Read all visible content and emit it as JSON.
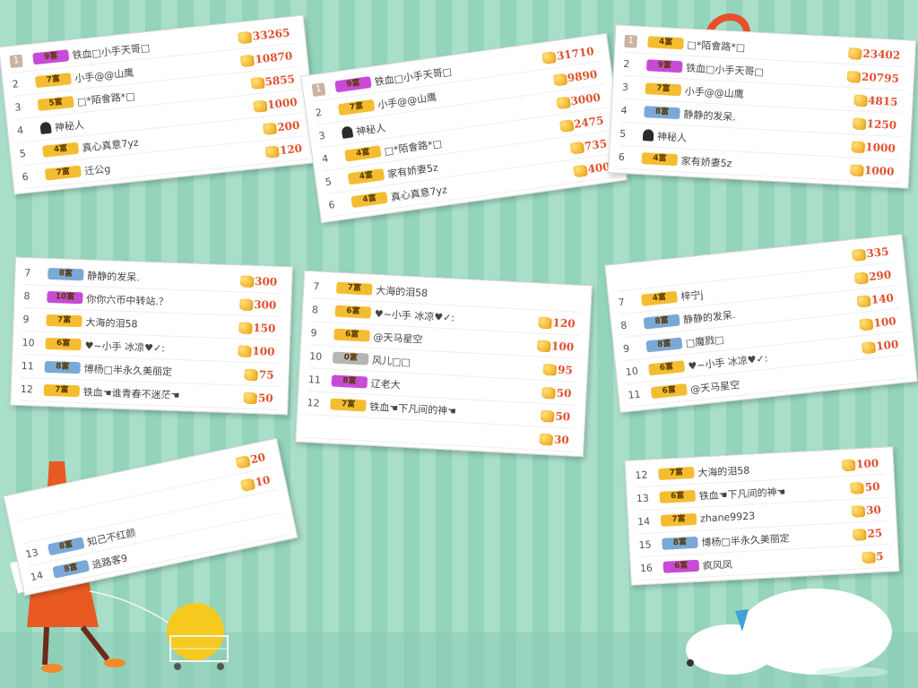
{
  "colors": {
    "background": "#a9dfc9",
    "score": "#e24f2c",
    "badge_gold": "#f4bd31",
    "badge_purple": "#c84bd6",
    "badge_blue": "#7aa9d7",
    "badge_gray": "#b5b5b5"
  },
  "icons": {
    "coin": "gold-coin-icon",
    "mystery": "mystery-person-icon"
  },
  "cards": [
    {
      "rows": [
        {
          "rank": "1",
          "top": true,
          "badge": "9富",
          "tier": "purple",
          "name": "铁血□小手天哥□",
          "score": "33265"
        },
        {
          "rank": "2",
          "badge": "7富",
          "tier": "gold",
          "name": "小手@@山鹰",
          "score": "10870"
        },
        {
          "rank": "3",
          "badge": "5富",
          "tier": "gold",
          "name": "□*陌會路*□",
          "score": "5855"
        },
        {
          "rank": "4",
          "mystery": true,
          "name": "神秘人",
          "score": "1000"
        },
        {
          "rank": "5",
          "badge": "4富",
          "tier": "gold",
          "name": "真心真意7yz",
          "score": "200"
        },
        {
          "rank": "6",
          "badge": "7富",
          "tier": "gold",
          "name": "迁公g",
          "score": "120"
        }
      ]
    },
    {
      "rows": [
        {
          "rank": "1",
          "top": true,
          "badge": "9富",
          "tier": "purple",
          "name": "铁血□小手天哥□",
          "score": "31710"
        },
        {
          "rank": "2",
          "badge": "7富",
          "tier": "gold",
          "name": "小手@@山鹰",
          "score": "9890"
        },
        {
          "rank": "3",
          "mystery": true,
          "name": "神秘人",
          "score": "3000"
        },
        {
          "rank": "4",
          "badge": "4富",
          "tier": "gold",
          "name": "□*陌會路*□",
          "score": "2475"
        },
        {
          "rank": "5",
          "badge": "4富",
          "tier": "gold",
          "name": "家有娇妻5z",
          "score": "735"
        },
        {
          "rank": "6",
          "badge": "4富",
          "tier": "gold",
          "name": "真心真意7yz",
          "score": "400"
        }
      ]
    },
    {
      "rows": [
        {
          "rank": "1",
          "top": true,
          "badge": "4富",
          "tier": "gold",
          "name": "□*陌會路*□",
          "score": "23402"
        },
        {
          "rank": "2",
          "badge": "9富",
          "tier": "purple",
          "name": "铁血□小手天哥□",
          "score": "20795"
        },
        {
          "rank": "3",
          "badge": "7富",
          "tier": "gold",
          "name": "小手@@山鹰",
          "score": "4815"
        },
        {
          "rank": "4",
          "badge": "8富",
          "tier": "blue",
          "name": "静静的发呆.",
          "score": "1250"
        },
        {
          "rank": "5",
          "mystery": true,
          "name": "神秘人",
          "score": "1000"
        },
        {
          "rank": "6",
          "badge": "4富",
          "tier": "gold",
          "name": "家有娇妻5z",
          "score": "1000"
        }
      ]
    },
    {
      "rows": [
        {
          "rank": "7",
          "badge": "8富",
          "tier": "blue",
          "name": "静静的发呆.",
          "score": "300"
        },
        {
          "rank": "8",
          "badge": "10富",
          "tier": "purple",
          "name": "你你六币中转站.？",
          "score": "300"
        },
        {
          "rank": "9",
          "badge": "7富",
          "tier": "gold",
          "name": "大海的泪58",
          "score": "150"
        },
        {
          "rank": "10",
          "badge": "6富",
          "tier": "gold",
          "name": "♥~小手 冰凉♥✓:",
          "score": "100"
        },
        {
          "rank": "11",
          "badge": "8富",
          "tier": "blue",
          "name": "博杨□半永久美丽定",
          "score": "75"
        },
        {
          "rank": "12",
          "badge": "7富",
          "tier": "gold",
          "name": "铁血☚谁青春不迷茫☚",
          "score": "50"
        }
      ]
    },
    {
      "rows": [
        {
          "rank": "7",
          "badge": "7富",
          "tier": "gold",
          "name": "大海的泪58",
          "score": ""
        },
        {
          "rank": "8",
          "badge": "6富",
          "tier": "gold",
          "name": "♥~小手 冰凉♥✓:",
          "score": "120"
        },
        {
          "rank": "9",
          "badge": "6富",
          "tier": "gold",
          "name": "@天马星空",
          "score": "100"
        },
        {
          "rank": "10",
          "badge": "0富",
          "tier": "gray",
          "name": "风儿□□",
          "score": "95"
        },
        {
          "rank": "11",
          "badge": "8富",
          "tier": "purple",
          "name": "辽老大",
          "score": "50"
        },
        {
          "rank": "12",
          "badge": "7富",
          "tier": "gold",
          "name": "铁血☚下凡间的神☚",
          "score": "50"
        },
        {
          "rank": "",
          "name": "",
          "score": "30"
        }
      ]
    },
    {
      "rows": [
        {
          "rank": "",
          "name": "",
          "score": "335"
        },
        {
          "rank": "7",
          "badge": "4富",
          "tier": "gold",
          "name": "梓宁j",
          "score": "290"
        },
        {
          "rank": "8",
          "badge": "8富",
          "tier": "blue",
          "name": "静静的发呆.",
          "score": "140"
        },
        {
          "rank": "9",
          "badge": "8富",
          "tier": "blue",
          "name": "□魔戮□",
          "score": "100"
        },
        {
          "rank": "10",
          "badge": "6富",
          "tier": "gold",
          "name": "♥~小手 冰凉♥✓:",
          "score": "100"
        },
        {
          "rank": "11",
          "badge": "6富",
          "tier": "gold",
          "name": "@天马星空",
          "score": ""
        }
      ]
    },
    {
      "rows": [
        {
          "rank": "",
          "name": "",
          "score": "20"
        },
        {
          "rank": "",
          "name": "",
          "score": "10"
        },
        {
          "rank": "13",
          "badge": "8富",
          "tier": "blue",
          "name": "知己不红颜",
          "score": ""
        },
        {
          "rank": "14",
          "badge": "8富",
          "tier": "blue",
          "name": "逃路客9",
          "score": ""
        }
      ]
    },
    {
      "rows": [
        {
          "rank": "12",
          "badge": "7富",
          "tier": "gold",
          "name": "大海的泪58",
          "score": "100"
        },
        {
          "rank": "13",
          "badge": "6富",
          "tier": "gold",
          "name": "铁血☚下凡间的神☚",
          "score": "50"
        },
        {
          "rank": "14",
          "badge": "7富",
          "tier": "gold",
          "name": "zhane9923",
          "score": "30"
        },
        {
          "rank": "15",
          "badge": "8富",
          "tier": "blue",
          "name": "博杨□半永久美丽定",
          "score": "25"
        },
        {
          "rank": "16",
          "badge": "6富",
          "tier": "purple",
          "name": "疯风凤",
          "score": "5"
        }
      ]
    }
  ]
}
